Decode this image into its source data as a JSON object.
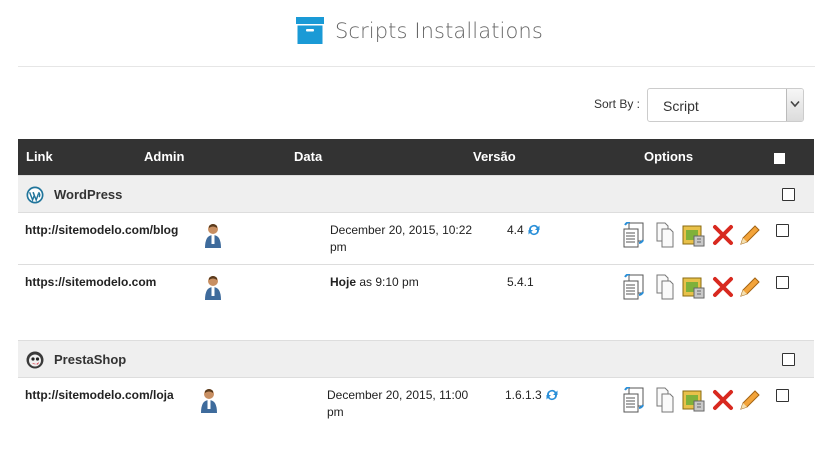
{
  "header": {
    "title": "Scripts Installations",
    "icon": "box-icon",
    "accent": "#1a9ad6"
  },
  "sort": {
    "label": "Sort By :",
    "selected": "Script"
  },
  "table": {
    "columns": [
      "Link",
      "Admin",
      "Data",
      "Versão",
      "Options"
    ]
  },
  "groups": [
    {
      "name": "WordPress",
      "icon": "wordpress-logo-icon",
      "rows": [
        {
          "link": "http://sitemodelo.com/blog",
          "date": "December 20, 2015, 10:22 pm",
          "date_bold": "",
          "version": "4.4",
          "upgrade": true
        },
        {
          "link": "https://sitemodelo.com",
          "date": "as 9:10 pm",
          "date_bold": "Hoje",
          "version": "5.4.1",
          "upgrade": false
        }
      ]
    },
    {
      "name": "PrestaShop",
      "icon": "prestashop-logo-icon",
      "rows": [
        {
          "link": "http://sitemodelo.com/loja",
          "date": "December 20, 2015, 11:00 pm",
          "date_bold": "",
          "version": "1.6.1.3",
          "upgrade": true
        }
      ]
    }
  ],
  "option_icons": [
    "backup-icon",
    "clone-icon",
    "staging-icon",
    "remove-icon",
    "edit-icon"
  ]
}
